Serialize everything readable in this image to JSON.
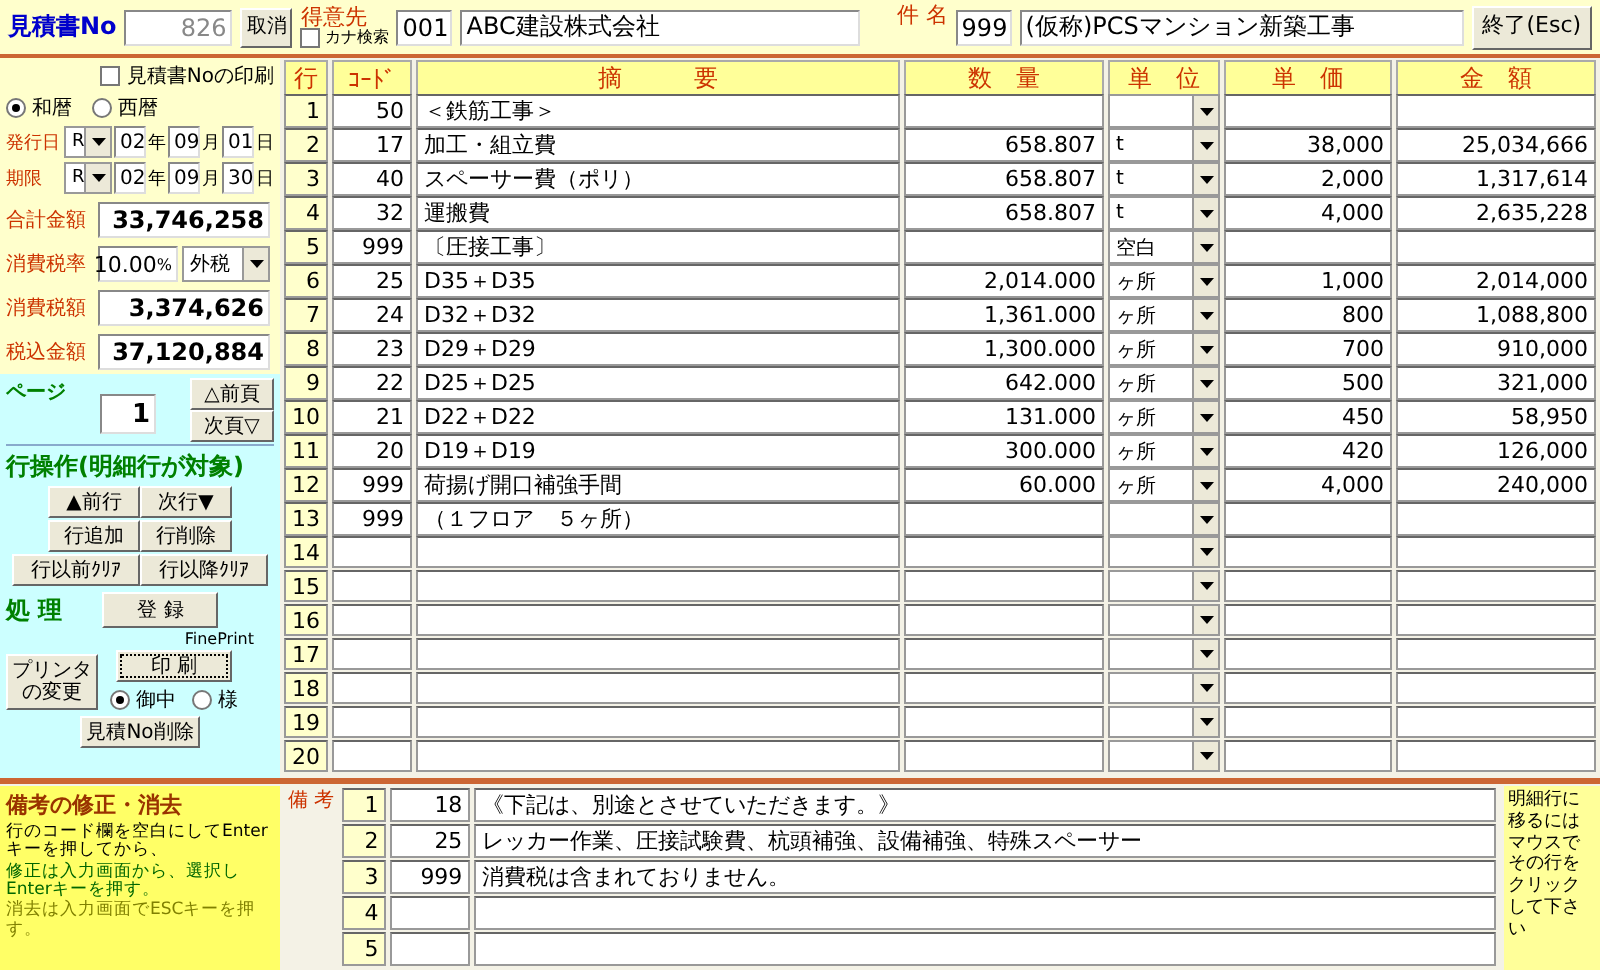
{
  "header": {
    "title": "見積書No",
    "estimate_no": "826",
    "cancel_button": "取消",
    "customer_label": "得意先",
    "kana_search": {
      "label": "カナ検索",
      "checked": false
    },
    "customer_code": "001",
    "customer_name": "ABC建設株式会社",
    "project_label": "件 名",
    "project_code": "999",
    "project_name": "(仮称)PCSマンション新築工事",
    "exit_button": "終了(Esc)"
  },
  "left": {
    "print_no": {
      "label": "見積書Noの印刷",
      "checked": false
    },
    "eras": [
      {
        "label": "和暦",
        "selected": true
      },
      {
        "label": "西暦",
        "selected": false
      }
    ],
    "dates": [
      {
        "label": "発行日",
        "era": "R",
        "year": "02",
        "year_unit": "年",
        "month": "09",
        "month_unit": "月",
        "day": "01",
        "day_unit": "日"
      },
      {
        "label": "期限",
        "era": "R",
        "year": "02",
        "year_unit": "年",
        "month": "09",
        "month_unit": "月",
        "day": "30",
        "day_unit": "日"
      }
    ],
    "summary": [
      {
        "kind": "amount",
        "label": "合計金額",
        "value": "33,746,258"
      },
      {
        "kind": "rate",
        "label": "消費税率",
        "value": "10.00",
        "unit": "%",
        "mode": "外税"
      },
      {
        "kind": "amount",
        "label": "消費税額",
        "value": "3,374,626"
      },
      {
        "kind": "amount",
        "label": "税込金額",
        "value": "37,120,884"
      }
    ],
    "page": {
      "label": "ページ",
      "value": "1",
      "prev_button": "△前頁",
      "next_button": "次頁▽"
    },
    "row_ops": {
      "title": "行操作(明細行が対象)",
      "buttons": [
        [
          "▲前行",
          "次行▼"
        ],
        [
          "行追加",
          "行削除"
        ],
        [
          "行以前ｸﾘｱ",
          "行以降ｸﾘｱ"
        ]
      ]
    },
    "process": {
      "title": "処 理",
      "register_button": "登 録",
      "fineprint": "FinePrint",
      "printer_button": "プリンタの変更",
      "print_button": "印 刷",
      "honorifics": [
        {
          "label": "御中",
          "selected": true
        },
        {
          "label": "様",
          "selected": false
        }
      ],
      "delete_button": "見積No削除"
    }
  },
  "table": {
    "columns": [
      "行",
      "ｺｰﾄﾞ",
      "摘　　　要",
      "数　量",
      "単　位",
      "単　価",
      "金　額"
    ],
    "rows": [
      {
        "no": "1",
        "code": "50",
        "description": "＜鉄筋工事＞"
      },
      {
        "no": "2",
        "code": "17",
        "description": "加工・組立費",
        "quantity": "658.807",
        "unit": "t",
        "unit_price": "38,000",
        "amount": "25,034,666"
      },
      {
        "no": "3",
        "code": "40",
        "description": "スペーサー費（ポリ）",
        "quantity": "658.807",
        "unit": "t",
        "unit_price": "2,000",
        "amount": "1,317,614"
      },
      {
        "no": "4",
        "code": "32",
        "description": "運搬費",
        "quantity": "658.807",
        "unit": "t",
        "unit_price": "4,000",
        "amount": "2,635,228"
      },
      {
        "no": "5",
        "code": "999",
        "description": "〔圧接工事〕",
        "unit": "空白"
      },
      {
        "no": "6",
        "code": "25",
        "description": "D35＋D35",
        "quantity": "2,014.000",
        "unit": "ヶ所",
        "unit_price": "1,000",
        "amount": "2,014,000"
      },
      {
        "no": "7",
        "code": "24",
        "description": "D32＋D32",
        "quantity": "1,361.000",
        "unit": "ヶ所",
        "unit_price": "800",
        "amount": "1,088,800"
      },
      {
        "no": "8",
        "code": "23",
        "description": "D29＋D29",
        "quantity": "1,300.000",
        "unit": "ヶ所",
        "unit_price": "700",
        "amount": "910,000"
      },
      {
        "no": "9",
        "code": "22",
        "description": "D25＋D25",
        "quantity": "642.000",
        "unit": "ヶ所",
        "unit_price": "500",
        "amount": "321,000"
      },
      {
        "no": "10",
        "code": "21",
        "description": "D22＋D22",
        "quantity": "131.000",
        "unit": "ヶ所",
        "unit_price": "450",
        "amount": "58,950"
      },
      {
        "no": "11",
        "code": "20",
        "description": "D19＋D19",
        "quantity": "300.000",
        "unit": "ヶ所",
        "unit_price": "420",
        "amount": "126,000"
      },
      {
        "no": "12",
        "code": "999",
        "description": "荷揚げ開口補強手間",
        "quantity": "60.000",
        "unit": "ヶ所",
        "unit_price": "4,000",
        "amount": "240,000"
      },
      {
        "no": "13",
        "code": "999",
        "description": "（１フロア　５ヶ所）"
      },
      {
        "no": "14"
      },
      {
        "no": "15"
      },
      {
        "no": "16"
      },
      {
        "no": "17"
      },
      {
        "no": "18"
      },
      {
        "no": "19"
      },
      {
        "no": "20"
      }
    ]
  },
  "notes": {
    "panel_title": "備考の修正・消去",
    "instructions": [
      {
        "text": "行のコード欄を空白にしてEnterキーを押してから、",
        "color": "#000000"
      },
      {
        "text": "修正は入力画面から、選択しEnterキーを押す。",
        "color": "#006600"
      },
      {
        "text": "消去は入力画面でESCキーを押す。",
        "color": "#808000"
      }
    ],
    "label": "備 考",
    "rows": [
      {
        "no": "1",
        "code": "18",
        "text": "《下記は、別途とさせていただきます。》"
      },
      {
        "no": "2",
        "code": "25",
        "text": "レッカー作業、圧接試験費、杭頭補強、設備補強、特殊スペーサー"
      },
      {
        "no": "3",
        "code": "999",
        "text": "消費税は含まれておりません。"
      },
      {
        "no": "4"
      },
      {
        "no": "5"
      }
    ],
    "hint": "明細行に移るにはマウスでその行をクリックして下さい"
  }
}
